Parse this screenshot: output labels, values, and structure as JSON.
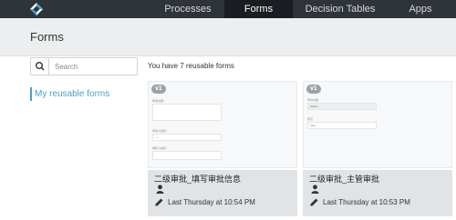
{
  "nav": {
    "items": [
      {
        "label": "Processes"
      },
      {
        "label": "Forms"
      },
      {
        "label": "Decision Tables"
      },
      {
        "label": "Apps"
      }
    ],
    "active": "Forms"
  },
  "page": {
    "title": "Forms"
  },
  "search": {
    "placeholder": "Search"
  },
  "sidebar": {
    "link_label": "My reusable forms"
  },
  "main": {
    "count_text": "You have 7 reusable forms"
  },
  "cards": [
    {
      "version": "v1",
      "title": "二级审批_填写审批信息",
      "updated": "Last Thursday at 10:54 PM",
      "preview": {
        "fields": [
          {
            "label": "申请内容*"
          },
          {
            "label": "申请人姓名*",
            "value": "----"
          },
          {
            "label": "审核人姓名*"
          }
        ]
      }
    },
    {
      "version": "v1",
      "title": "二级审批_主管审批",
      "updated": "Last Thursday at 10:53 PM",
      "preview": {
        "fields": [
          {
            "label": "申请内容",
            "value": "Select..."
          },
          {
            "label": "意见",
            "value": "*yes"
          }
        ]
      }
    }
  ],
  "colors": {
    "accent": "#4aa3c3",
    "topbar": "#2f3439",
    "active_nav": "#1a1d21",
    "card_info": "#e0e4e7"
  }
}
